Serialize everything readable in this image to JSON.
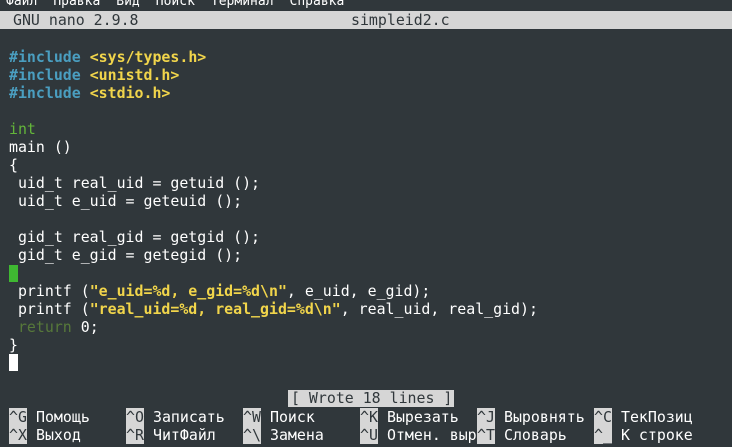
{
  "menu": [
    "Файл",
    "Правка",
    "Вид",
    "Поиск",
    "Терминал",
    "Справка"
  ],
  "title": {
    "version": "GNU nano 2.9.8",
    "filename": "simpleid2.c"
  },
  "code": {
    "inc1_kw": "#include",
    "inc1_hdr": "<sys/types.h>",
    "inc2_kw": "#include",
    "inc2_hdr": "<unistd.h>",
    "inc3_kw": "#include",
    "inc3_hdr": "<stdio.h>",
    "l_int": "int",
    "l_main": "main ()",
    "l_open": "{",
    "l_uid": " uid_t real_uid = getuid ();",
    "l_euid": " uid_t e_uid = geteuid ();",
    "l_gid": " gid_t real_gid = getgid ();",
    "l_egid": " gid_t e_gid = getegid ();",
    "p1_a": " printf (",
    "p1_str": "\"e_uid=%d, e_gid=%d\\n\"",
    "p1_b": ", e_uid, e_gid);",
    "p2_a": " printf (",
    "p2_str": "\"real_uid=%d, real_gid=%d\\n\"",
    "p2_b": ", real_uid, real_gid);",
    "ret_kw": " return",
    "ret_rest": " 0;",
    "l_close": "}"
  },
  "status": "[ Wrote 18 lines ]",
  "shortcuts": {
    "r1": [
      {
        "key": "^G",
        "label": "Помощь"
      },
      {
        "key": "^O",
        "label": "Записать"
      },
      {
        "key": "^W",
        "label": "Поиск"
      },
      {
        "key": "^K",
        "label": "Вырезать"
      },
      {
        "key": "^J",
        "label": "Выровнять"
      },
      {
        "key": "^C",
        "label": "ТекПозиц"
      }
    ],
    "r2": [
      {
        "key": "^X",
        "label": "Выход"
      },
      {
        "key": "^R",
        "label": "ЧитФайл"
      },
      {
        "key": "^\\",
        "label": "Замена"
      },
      {
        "key": "^U",
        "label": "Отмен. выр"
      },
      {
        "key": "^T",
        "label": "Словарь"
      },
      {
        "key": "^_",
        "label": "К строке"
      }
    ]
  },
  "colors": {
    "background": "#30373b",
    "preprocessor": "#4a9ec0",
    "include_header": "#f1d54b",
    "type_keyword": "#63b53a",
    "string": "#f1d54b",
    "return_keyword": "#57793a",
    "cursor_mark": "#3fb832",
    "bar": "#d6d6d6"
  }
}
